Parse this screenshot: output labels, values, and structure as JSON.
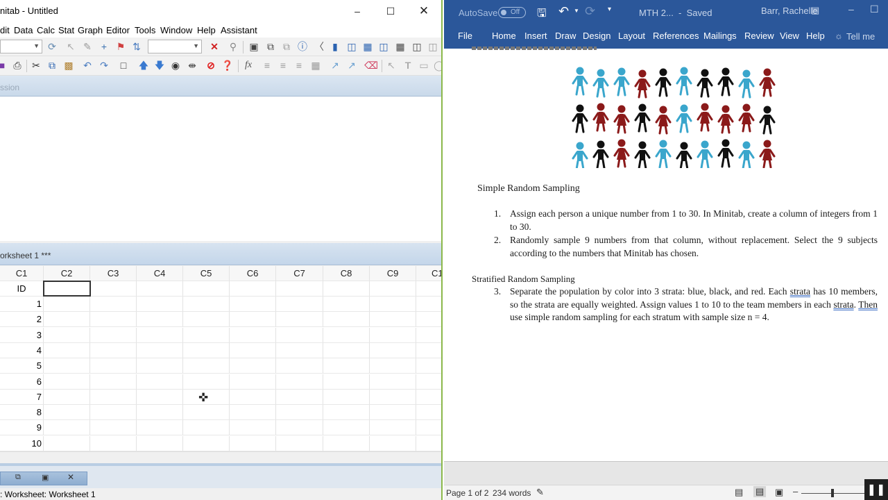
{
  "minitab": {
    "title": "nitab - Untitled",
    "menu": [
      "dit",
      "Data",
      "Calc",
      "Stat",
      "Graph",
      "Editor",
      "Tools",
      "Window",
      "Help",
      "Assistant"
    ],
    "session_label": "ssion",
    "worksheet_title": "orksheet 1 ***",
    "columns": [
      "C1",
      "C2",
      "C3",
      "C4",
      "C5",
      "C6",
      "C7",
      "C8",
      "C9",
      "C1"
    ],
    "column_names": [
      "ID",
      "",
      "",
      "",
      "",
      "",
      "",
      "",
      "",
      ""
    ],
    "row_values": [
      "1",
      "2",
      "3",
      "4",
      "5",
      "6",
      "7",
      "8",
      "9",
      "10"
    ],
    "status_text": ": Worksheet: Worksheet 1"
  },
  "word": {
    "autosave_label": "AutoSave",
    "autosave_state": "Off",
    "doc_title": "MTH 2...  -  Saved",
    "user_name": "Barr, Rachelle",
    "ribbon_tabs": [
      "File",
      "Home",
      "Insert",
      "Draw",
      "Design",
      "Layout",
      "References",
      "Mailings",
      "Review",
      "View",
      "Help"
    ],
    "tell_me": "Tell me",
    "page_info": "Page 1 of 2",
    "word_count": "234 words",
    "figure": {
      "people_colors": [
        [
          "blue",
          "blue",
          "blue",
          "red",
          "black",
          "blue",
          "black",
          "black",
          "blue",
          "red"
        ],
        [
          "black",
          "red",
          "red",
          "black",
          "red",
          "blue",
          "red",
          "red",
          "red",
          "black"
        ],
        [
          "blue",
          "black",
          "red",
          "black",
          "blue",
          "black",
          "blue",
          "black",
          "blue",
          "red"
        ]
      ],
      "colors": {
        "blue": "#3aa6cc",
        "red": "#8b1a1a",
        "black": "#111111"
      }
    },
    "section1_heading": "Simple Random Sampling",
    "list_items": [
      {
        "num": "1.",
        "text": "Assign each person a unique number from 1 to 30. In Minitab, create a column of integers from 1 to 30."
      },
      {
        "num": "2.",
        "text": "Randomly sample 9 numbers from that column, without replacement. Select the 9 subjects according to the numbers that Minitab has chosen."
      }
    ],
    "section2_heading": "Stratified Random Sampling",
    "item3": {
      "num": "3.",
      "t1": "Separate the population by color into 3 strata: blue, black, and red. Each ",
      "w1": "strata",
      "t2": " has 10 members, so the strata are equally weighted. Assign values 1 to 10 to the team members in each ",
      "w2": "strata",
      "t3": ". ",
      "w3": "Then",
      "t4": " use simple random sampling for each stratum with sample size n = 4."
    }
  },
  "colors": {
    "word_blue": "#2b579a",
    "minitab_accent": "#8bb84a"
  }
}
